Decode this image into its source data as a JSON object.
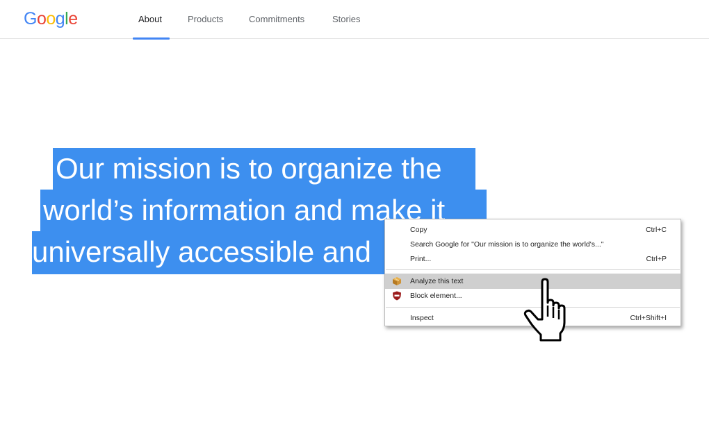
{
  "header": {
    "logo_letters": [
      {
        "char": "G",
        "color": "#4285f4"
      },
      {
        "char": "o",
        "color": "#ea4335"
      },
      {
        "char": "o",
        "color": "#fbbc05"
      },
      {
        "char": "g",
        "color": "#4285f4"
      },
      {
        "char": "l",
        "color": "#34a853"
      },
      {
        "char": "e",
        "color": "#ea4335"
      }
    ],
    "nav": [
      {
        "label": "About",
        "active": true
      },
      {
        "label": "Products",
        "active": false
      },
      {
        "label": "Commitments",
        "active": false
      },
      {
        "label": "Stories",
        "active": false
      }
    ],
    "accent_color": "#4285f4"
  },
  "mission": {
    "lines": [
      "Our mission is to organize the",
      "world’s information and make it",
      "universally accessible and"
    ],
    "selection_color": "#3d8fef"
  },
  "context_menu": {
    "items": [
      {
        "label": "Copy",
        "shortcut": "Ctrl+C"
      },
      {
        "label": "Search Google for \"Our mission is to organize the world's...\"",
        "shortcut": ""
      },
      {
        "label": "Print...",
        "shortcut": "Ctrl+P"
      },
      {
        "label": "Analyze this text",
        "shortcut": "",
        "icon": "package-icon",
        "hovered": true
      },
      {
        "label": "Block element...",
        "shortcut": "",
        "icon": "shield-block-icon"
      },
      {
        "label": "Inspect",
        "shortcut": "Ctrl+Shift+I"
      }
    ],
    "hover_color": "#cfcfcf"
  },
  "cursor": {
    "icon": "hand-pointer-icon"
  }
}
